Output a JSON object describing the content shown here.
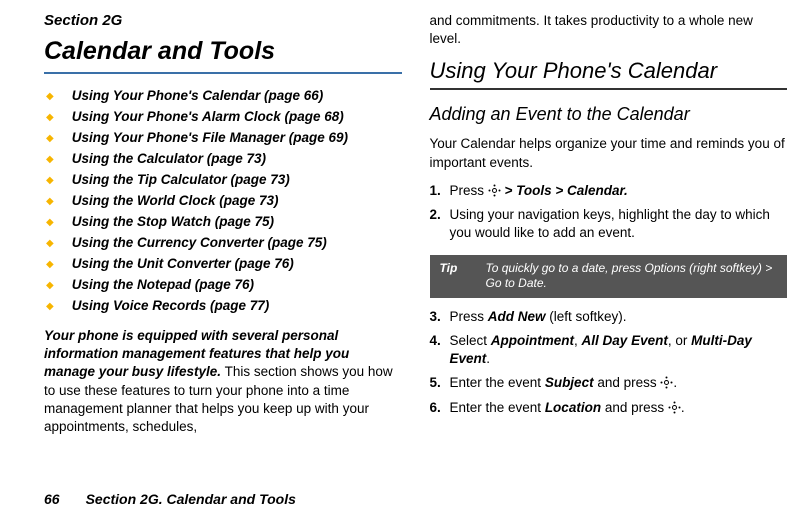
{
  "left": {
    "section_label": "Section 2G",
    "chapter_title": "Calendar and Tools",
    "toc": [
      "Using Your Phone's Calendar (page 66)",
      "Using Your Phone's Alarm Clock (page 68)",
      "Using Your Phone's File Manager (page 69)",
      "Using the Calculator (page 73)",
      "Using the Tip Calculator (page 73)",
      "Using the World Clock (page 73)",
      "Using the Stop Watch (page 75)",
      "Using the Currency Converter (page 75)",
      "Using the Unit Converter (page 76)",
      "Using the Notepad (page 76)",
      "Using Voice Records (page 77)"
    ],
    "intro_lead": "Your phone is equipped with several personal information management features that help you manage your busy lifestyle.",
    "intro_rest": " This section shows you how to use these features to turn your phone into a time management planner that helps you keep up with your appointments, schedules, "
  },
  "right": {
    "cont": "and commitments. It takes productivity to a whole new level.",
    "h2": "Using Your Phone's Calendar",
    "h3": "Adding an Event to the Calendar",
    "p1": "Your Calendar helps organize your time and reminds you of important events.",
    "step1_a": "Press ",
    "step1_b": " > Tools > Calendar.",
    "step2": "Using your navigation keys, highlight the day to which you would like to add an event.",
    "tip_label": "Tip",
    "tip_text": "To quickly go to a date, press Options (right softkey) > Go to Date.",
    "step3_a": "Press ",
    "step3_b": "Add New",
    "step3_c": " (left softkey).",
    "step4_a": "Select ",
    "step4_b": "Appointment",
    "step4_c": ", ",
    "step4_d": "All Day Event",
    "step4_e": ", or ",
    "step4_f": "Multi-Day Event",
    "step4_g": ".",
    "step5_a": "Enter the event ",
    "step5_b": "Subject",
    "step5_c": " and press ",
    "step5_d": ".",
    "step6_a": "Enter the event ",
    "step6_b": "Location",
    "step6_c": " and press ",
    "step6_d": "."
  },
  "footer": {
    "page": "66",
    "title": "Section 2G. Calendar and Tools"
  }
}
